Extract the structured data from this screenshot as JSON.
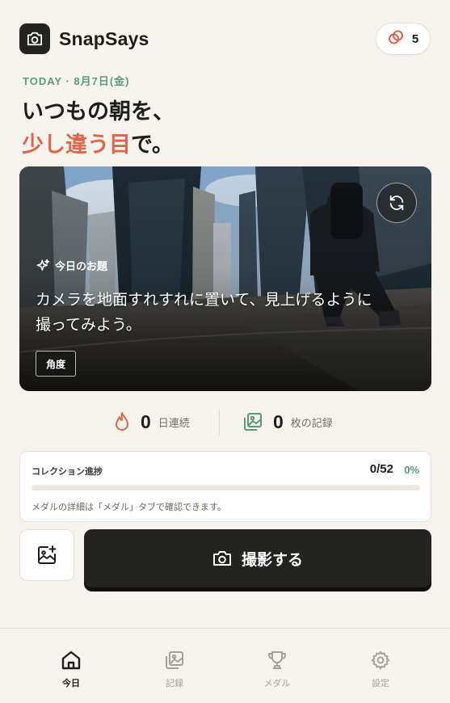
{
  "app": {
    "name": "SnapSays",
    "coin_count": "5"
  },
  "date_line": "TODAY · 8月7日(金)",
  "headline": {
    "line1": "いつもの朝を、",
    "accent": "少し違う目",
    "suffix": "で。"
  },
  "prompt": {
    "tag": "今日のお題",
    "text": "カメラを地面すれすれに置いて、見上げるように撮ってみよう。",
    "category": "角度"
  },
  "stats": {
    "streak": {
      "value": "0",
      "label": "日連続"
    },
    "records": {
      "value": "0",
      "label": "枚の記録"
    }
  },
  "collection": {
    "title": "コレクション進捗",
    "count": "0/52",
    "percent": "0%",
    "progress": 0,
    "note": "メダルの詳細は「メダル」タブで確認できます。"
  },
  "actions": {
    "shoot_label": "撮影する"
  },
  "nav": [
    {
      "label": "今日",
      "icon": "home-icon",
      "active": true
    },
    {
      "label": "記録",
      "icon": "photo-album-icon",
      "active": false
    },
    {
      "label": "メダル",
      "icon": "trophy-icon",
      "active": false
    },
    {
      "label": "設定",
      "icon": "gear-icon",
      "active": false
    }
  ],
  "colors": {
    "accent_red": "#e3654b",
    "accent_green": "#5c9a7e",
    "dark": "#232320",
    "background": "#f6f3ee"
  }
}
